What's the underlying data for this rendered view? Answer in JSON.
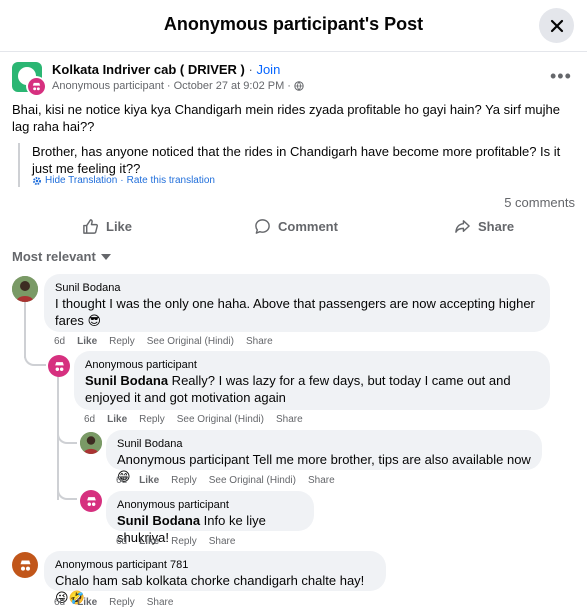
{
  "modal": {
    "title": "Anonymous participant's Post"
  },
  "post": {
    "group_name": "Kolkata Indriver cab ( DRIVER )",
    "separator": " · ",
    "join_label": "Join",
    "author": "Anonymous participant",
    "timestamp": "October 27 at 9:02 PM",
    "text": "Bhai, kisi ne notice kiya kya Chandigarh mein rides zyada profitable ho gayi hain? Ya sirf mujhe lag raha hai??",
    "translation": "Brother, has anyone noticed that the rides in Chandigarh have become more profitable? Is it just me feeling it??",
    "hide_translation": "Hide Translation",
    "rate_translation": "Rate this translation",
    "comment_count": "5 comments"
  },
  "actions": {
    "like": "Like",
    "comment": "Comment",
    "share": "Share"
  },
  "sort_label": "Most relevant",
  "comments": [
    {
      "author": "Sunil Bodana",
      "text": "I thought I was the only one haha. Above that passengers are now accepting higher fares 😎",
      "time": "6d",
      "like": "Like",
      "reply": "Reply",
      "original": "See Original (Hindi)",
      "share": "Share"
    },
    {
      "author": "Anonymous participant",
      "mention": "Sunil Bodana",
      "text": " Really? I was lazy for a few days, but today I came out and enjoyed it and got motivation again",
      "time": "6d",
      "like": "Like",
      "reply": "Reply",
      "original": "See Original (Hindi)",
      "share": "Share"
    },
    {
      "author": "Sunil Bodana",
      "text": "Anonymous participant Tell me more brother, tips are also available now 😁",
      "time": "6d",
      "like": "Like",
      "reply": "Reply",
      "original": "See Original (Hindi)",
      "share": "Share"
    },
    {
      "author": "Anonymous participant",
      "mention": "Sunil Bodana",
      "text": " Info ke liye shukriya!",
      "time": "6d",
      "like": "Like",
      "reply": "Reply",
      "share": "Share"
    },
    {
      "author": "Anonymous participant 781",
      "text": "Chalo ham sab kolkata chorke chandigarh chalte hay!😜🤣",
      "time": "6d",
      "like": "Like",
      "reply": "Reply",
      "share": "Share"
    }
  ]
}
